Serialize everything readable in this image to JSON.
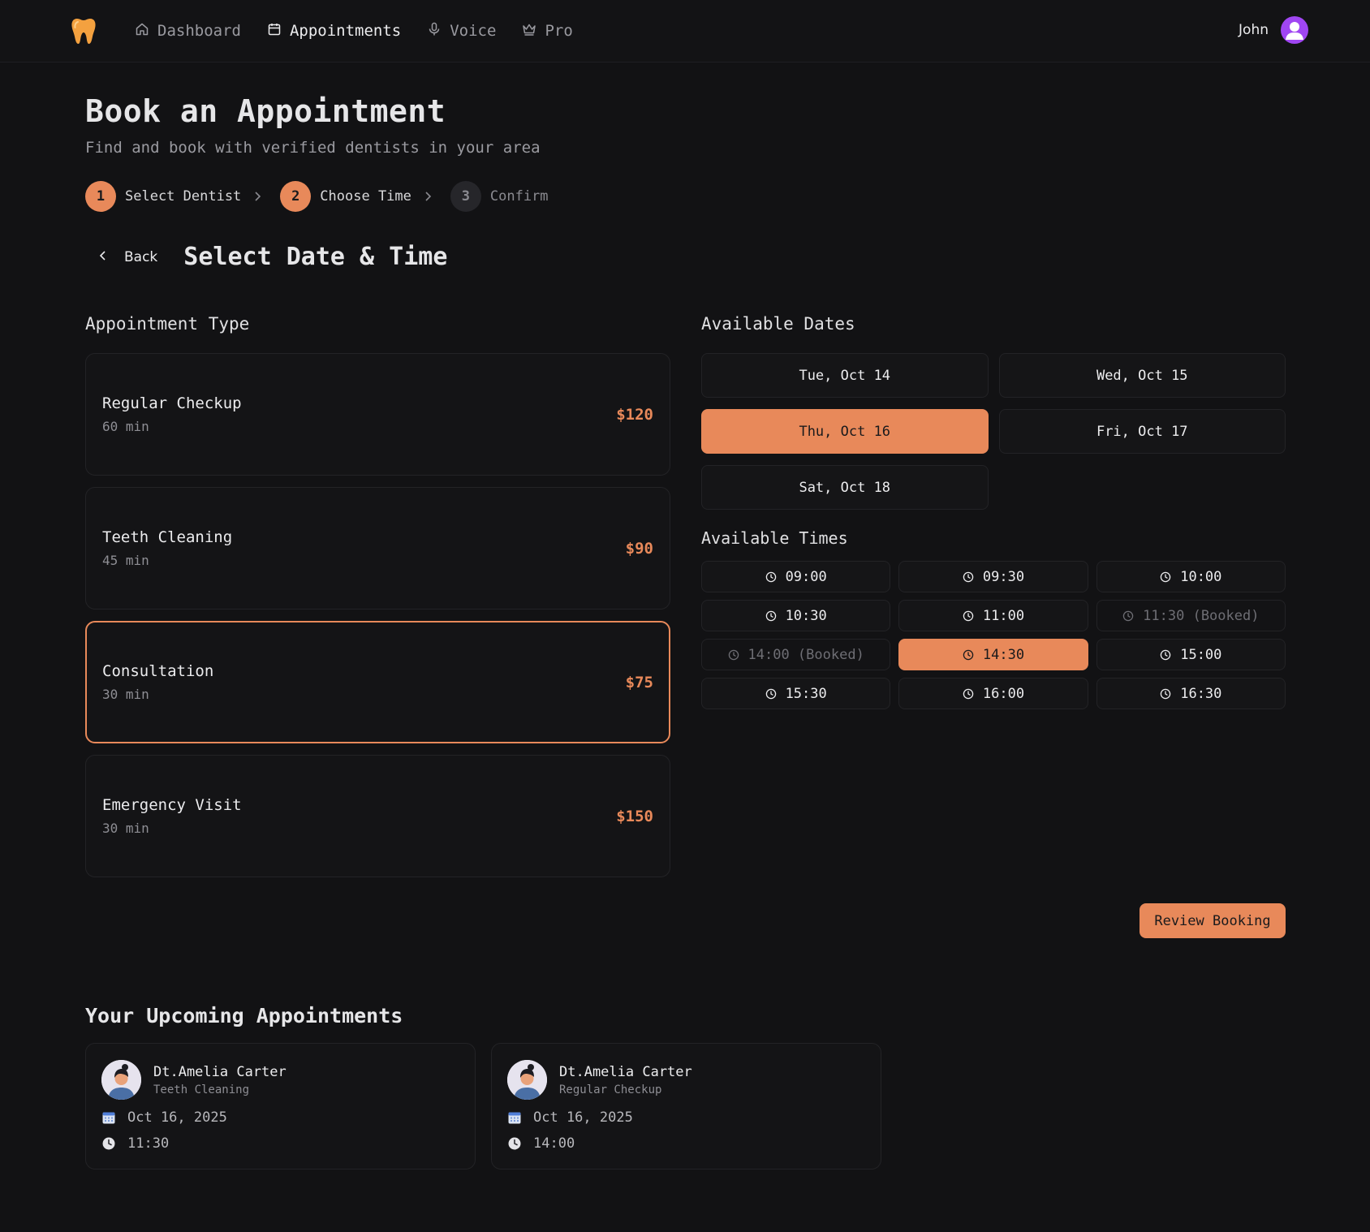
{
  "nav": {
    "items": [
      {
        "label": "Dashboard",
        "icon": "home-icon"
      },
      {
        "label": "Appointments",
        "icon": "calendar-icon"
      },
      {
        "label": "Voice",
        "icon": "microphone-icon"
      },
      {
        "label": "Pro",
        "icon": "crown-icon"
      }
    ],
    "active": "Appointments",
    "user_name": "John"
  },
  "header": {
    "title": "Book an Appointment",
    "subtitle": "Find and book with verified dentists in your area"
  },
  "steps": [
    {
      "num": "1",
      "label": "Select Dentist",
      "state": "done"
    },
    {
      "num": "2",
      "label": "Choose Time",
      "state": "done"
    },
    {
      "num": "3",
      "label": "Confirm",
      "state": "pending"
    }
  ],
  "section": {
    "back_label": "Back",
    "title": "Select Date & Time"
  },
  "appointment_types": {
    "title": "Appointment Type",
    "items": [
      {
        "name": "Regular Checkup",
        "duration": "60 min",
        "price": "$120",
        "selected": false
      },
      {
        "name": "Teeth Cleaning",
        "duration": "45 min",
        "price": "$90",
        "selected": false
      },
      {
        "name": "Consultation",
        "duration": "30 min",
        "price": "$75",
        "selected": true
      },
      {
        "name": "Emergency Visit",
        "duration": "30 min",
        "price": "$150",
        "selected": false
      }
    ]
  },
  "dates": {
    "title": "Available Dates",
    "items": [
      {
        "label": "Tue, Oct 14",
        "selected": false
      },
      {
        "label": "Wed, Oct 15",
        "selected": false
      },
      {
        "label": "Thu, Oct 16",
        "selected": true
      },
      {
        "label": "Fri, Oct 17",
        "selected": false
      },
      {
        "label": "Sat, Oct 18",
        "selected": false
      }
    ]
  },
  "times": {
    "title": "Available Times",
    "items": [
      {
        "label": "09:00",
        "state": "available"
      },
      {
        "label": "09:30",
        "state": "available"
      },
      {
        "label": "10:00",
        "state": "available"
      },
      {
        "label": "10:30",
        "state": "available"
      },
      {
        "label": "11:00",
        "state": "available"
      },
      {
        "label": "11:30 (Booked)",
        "state": "booked"
      },
      {
        "label": "14:00 (Booked)",
        "state": "booked"
      },
      {
        "label": "14:30",
        "state": "selected"
      },
      {
        "label": "15:00",
        "state": "available"
      },
      {
        "label": "15:30",
        "state": "available"
      },
      {
        "label": "16:00",
        "state": "available"
      },
      {
        "label": "16:30",
        "state": "available"
      }
    ]
  },
  "review_label": "Review Booking",
  "upcoming": {
    "title": "Your Upcoming Appointments",
    "items": [
      {
        "doctor": "Dt.Amelia Carter",
        "type": "Teeth Cleaning",
        "date": "Oct 16, 2025",
        "time": "11:30"
      },
      {
        "doctor": "Dt.Amelia Carter",
        "type": "Regular Checkup",
        "date": "Oct 16, 2025",
        "time": "14:00"
      }
    ]
  },
  "colors": {
    "accent": "#e8895a",
    "background": "#121214",
    "avatar": "#a046f2"
  }
}
